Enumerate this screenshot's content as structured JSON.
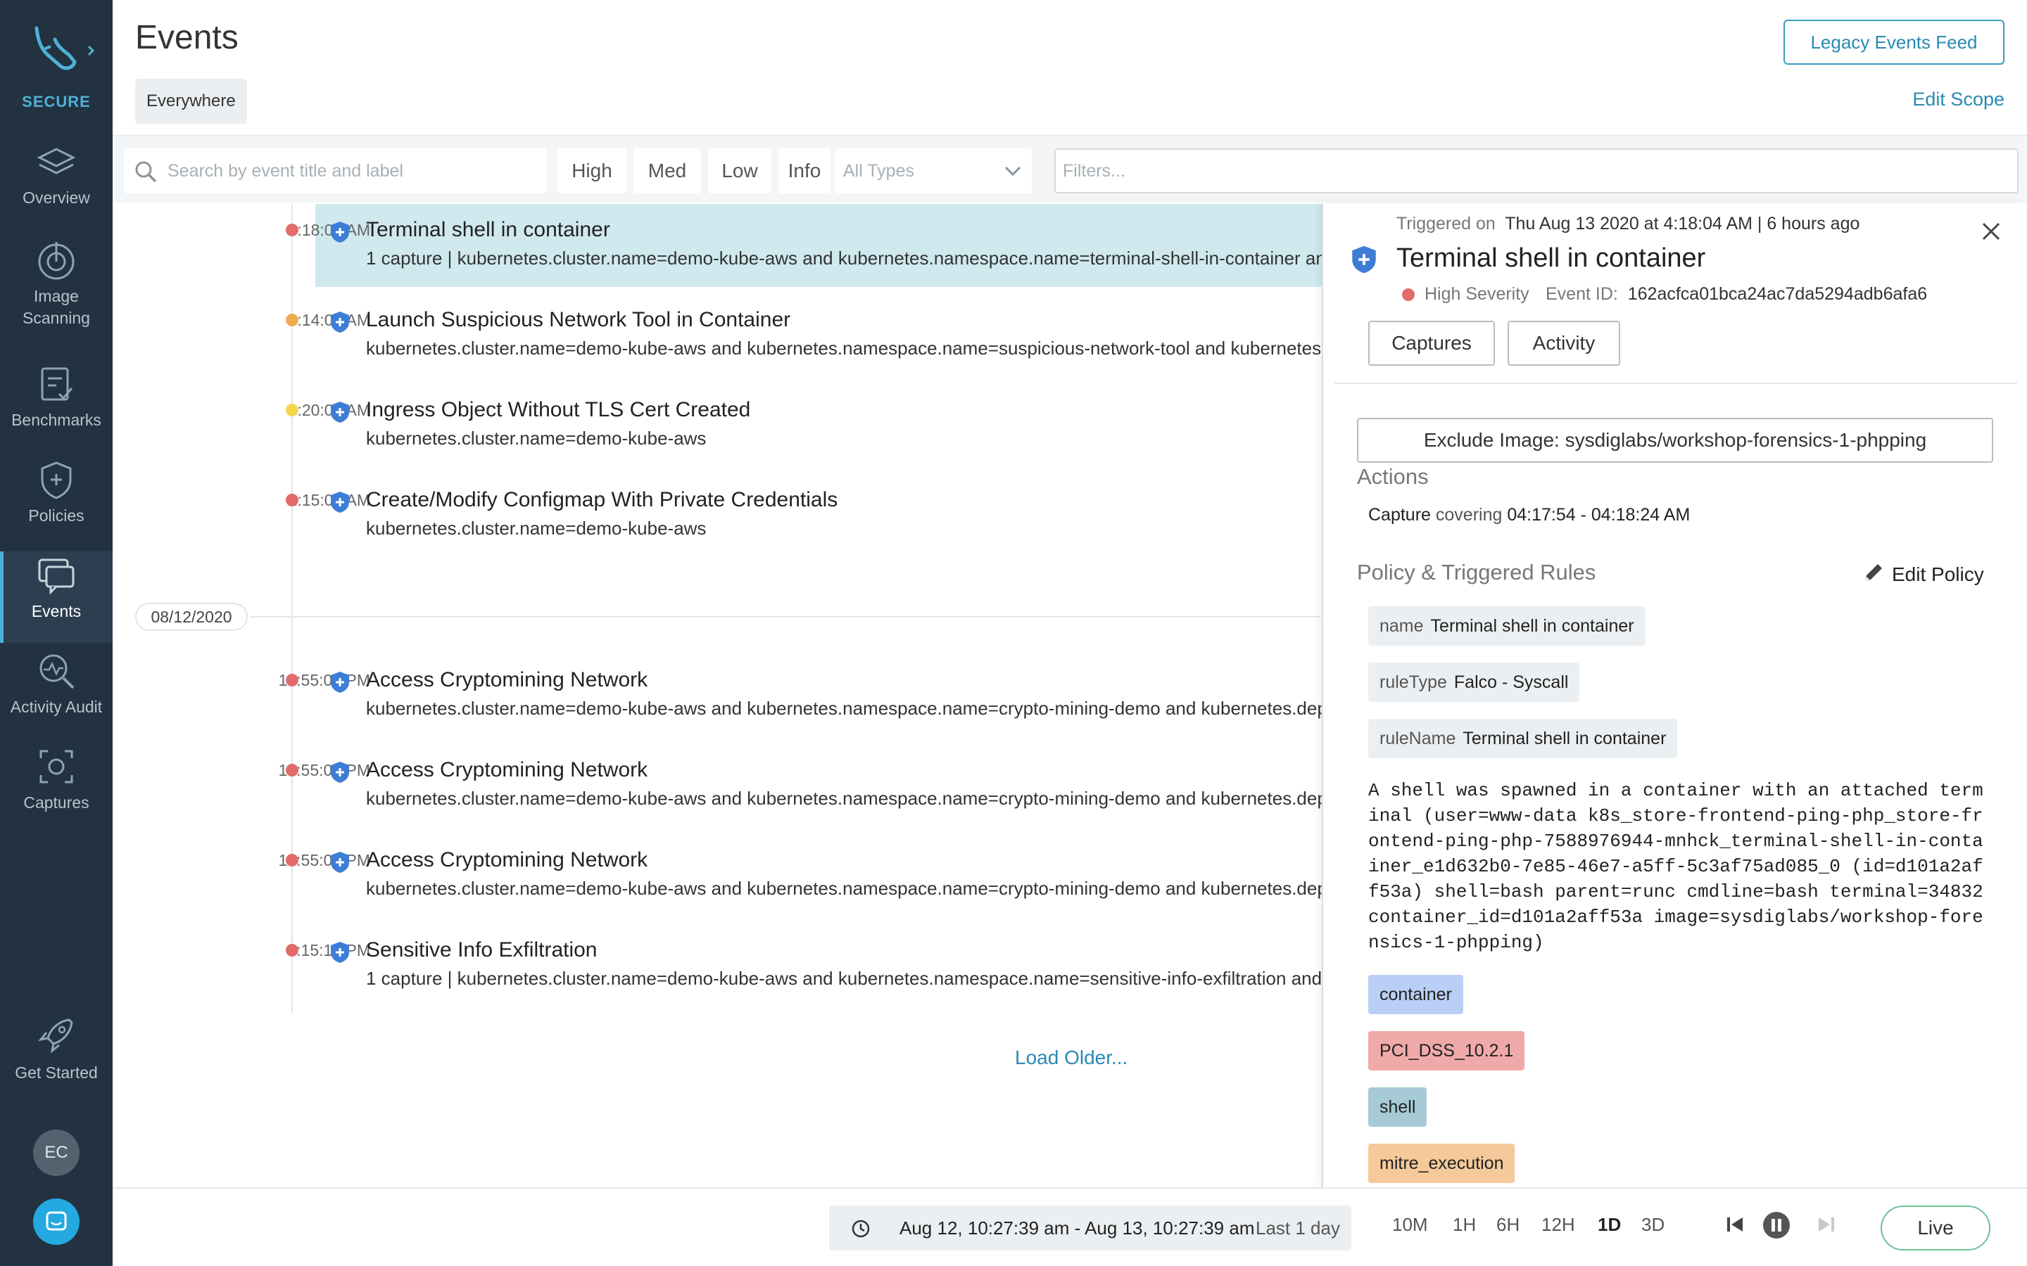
{
  "app": {
    "brand": "SECURE",
    "page_title": "Events"
  },
  "colors": {
    "accent": "#2a8ab3",
    "sidebar": "#223240",
    "high": "#e26b6b",
    "medium": "#f0ad4e",
    "low": "#f2d64b",
    "selected_row": "#cfe9ee"
  },
  "sidebar": {
    "items": [
      {
        "label_1": "Overview",
        "label_2": "",
        "icon": "layers-icon"
      },
      {
        "label_1": "Image",
        "label_2": "Scanning",
        "icon": "scan-icon"
      },
      {
        "label_1": "Benchmarks",
        "label_2": "",
        "icon": "clipboard-check-icon"
      },
      {
        "label_1": "Policies",
        "label_2": "",
        "icon": "shield-plus-icon"
      },
      {
        "label_1": "Events",
        "label_2": "",
        "icon": "chat-alert-icon",
        "active": true
      },
      {
        "label_1": "Activity Audit",
        "label_2": "",
        "icon": "search-pulse-icon"
      },
      {
        "label_1": "Captures",
        "label_2": "",
        "icon": "capture-icon"
      }
    ],
    "get_started": "Get Started",
    "avatar_initials": "EC"
  },
  "header": {
    "scope_chip": "Everywhere",
    "legacy_button": "Legacy Events Feed",
    "edit_scope": "Edit Scope"
  },
  "filters": {
    "search_placeholder": "Search by event title and label",
    "severity": [
      "High",
      "Med",
      "Low",
      "Info"
    ],
    "type_select": "All Types",
    "filters_placeholder": "Filters..."
  },
  "events": [
    {
      "time": "4:18:04 AM",
      "severity": "high",
      "title": "Terminal shell in container",
      "subtitle": "1 capture | kubernetes.cluster.name=demo-kube-aws and kubernetes.namespace.name=terminal-shell-in-container and kubernetes.deployment.name=store-frontend-ping-php",
      "selected": true
    },
    {
      "time": "4:14:04 AM",
      "severity": "medium",
      "title": "Launch Suspicious Network Tool in Container",
      "subtitle": "kubernetes.cluster.name=demo-kube-aws and kubernetes.namespace.name=suspicious-network-tool and kubernetes.deployment.name=network-tool"
    },
    {
      "time": "3:20:01 AM",
      "severity": "low",
      "title": "Ingress Object Without TLS Cert Created",
      "subtitle": "kubernetes.cluster.name=demo-kube-aws"
    },
    {
      "time": "1:15:04 AM",
      "severity": "high",
      "title": "Create/Modify Configmap With Private Credentials",
      "subtitle": "kubernetes.cluster.name=demo-kube-aws"
    },
    {
      "time": "10:55:04 PM",
      "severity": "high",
      "title": "Access Cryptomining Network",
      "subtitle": "kubernetes.cluster.name=demo-kube-aws and kubernetes.namespace.name=crypto-mining-demo and kubernetes.deployment.name=crypto-mining"
    },
    {
      "time": "10:55:04 PM",
      "severity": "high",
      "title": "Access Cryptomining Network",
      "subtitle": "kubernetes.cluster.name=demo-kube-aws and kubernetes.namespace.name=crypto-mining-demo and kubernetes.deployment.name=crypto-mining"
    },
    {
      "time": "10:55:03 PM",
      "severity": "high",
      "title": "Access Cryptomining Network",
      "subtitle": "kubernetes.cluster.name=demo-kube-aws and kubernetes.namespace.name=crypto-mining-demo and kubernetes.deployment.name=crypto-mining"
    },
    {
      "time": "3:15:10 PM",
      "severity": "high",
      "title": "Sensitive Info Exfiltration",
      "subtitle": "1 capture | kubernetes.cluster.name=demo-kube-aws and kubernetes.namespace.name=sensitive-info-exfiltration and kubernetes.deployment.name=sensitive-info"
    }
  ],
  "date_separator": "08/12/2020",
  "load_older": "Load Older...",
  "detail": {
    "triggered_label": "Triggered on",
    "triggered_value": "Thu Aug 13 2020 at 4:18:04 AM | 6 hours ago",
    "title": "Terminal shell in container",
    "severity": "High Severity",
    "event_id_label": "Event ID:",
    "event_id": "162acfca01bca24ac7da5294adb6afa6",
    "tabs": [
      "Captures",
      "Activity"
    ],
    "exclude_button": "Exclude Image: sysdiglabs/workshop-forensics-1-phpping",
    "actions_heading": "Actions",
    "capture_label": "Capture",
    "capture_text": "covering",
    "capture_range": "04:17:54 - 04:18:24 AM",
    "policy_heading": "Policy & Triggered Rules",
    "edit_policy": "Edit Policy",
    "rules": [
      {
        "key": "name",
        "value": "Terminal shell in container"
      },
      {
        "key": "ruleType",
        "value": "Falco - Syscall"
      },
      {
        "key": "ruleName",
        "value": "Terminal shell in container"
      }
    ],
    "description": "A shell was spawned in a container with an attached terminal (user=www-data k8s_store-frontend-ping-php_store-frontend-ping-php-7588976944-mnhck_terminal-shell-in-container_e1d632b0-7e85-46e7-a5ff-5c3af75ad085_0 (id=d101a2aff53a) shell=bash parent=runc cmdline=bash terminal=34832 container_id=d101a2aff53a image=sysdiglabs/workshop-forensics-1-phpping)",
    "tags": [
      {
        "label": "container",
        "color": "#b9cff5"
      },
      {
        "label": "PCI_DSS_10.2.1",
        "color": "#f0a9a9"
      },
      {
        "label": "shell",
        "color": "#a7cbd6"
      },
      {
        "label": "mitre_execution",
        "color": "#f5c99a"
      }
    ]
  },
  "bottombar": {
    "range": "Aug 12, 10:27:39 am - Aug 13, 10:27:39 am",
    "last": "Last 1 day",
    "time_ranges": [
      "10M",
      "1H",
      "6H",
      "12H",
      "1D",
      "3D"
    ],
    "active_range": "1D",
    "live": "Live"
  }
}
